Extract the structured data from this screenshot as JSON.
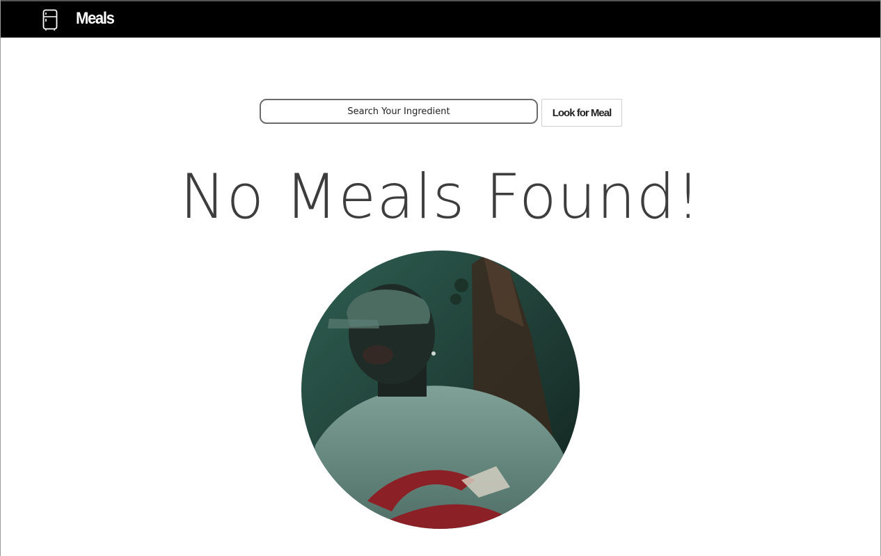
{
  "navbar": {
    "brand": "Meals",
    "icon": "fridge-icon",
    "background": "#000000"
  },
  "search": {
    "placeholder": "Search Your Ingredient",
    "value": "",
    "button_label": "Look for Meal"
  },
  "main": {
    "message": "No Meals Found!",
    "image": {
      "shape": "circle",
      "description_icon": "person-photo"
    }
  },
  "colors": {
    "text": "#3d3d3d",
    "photo_tint": "#2d5a4c"
  }
}
